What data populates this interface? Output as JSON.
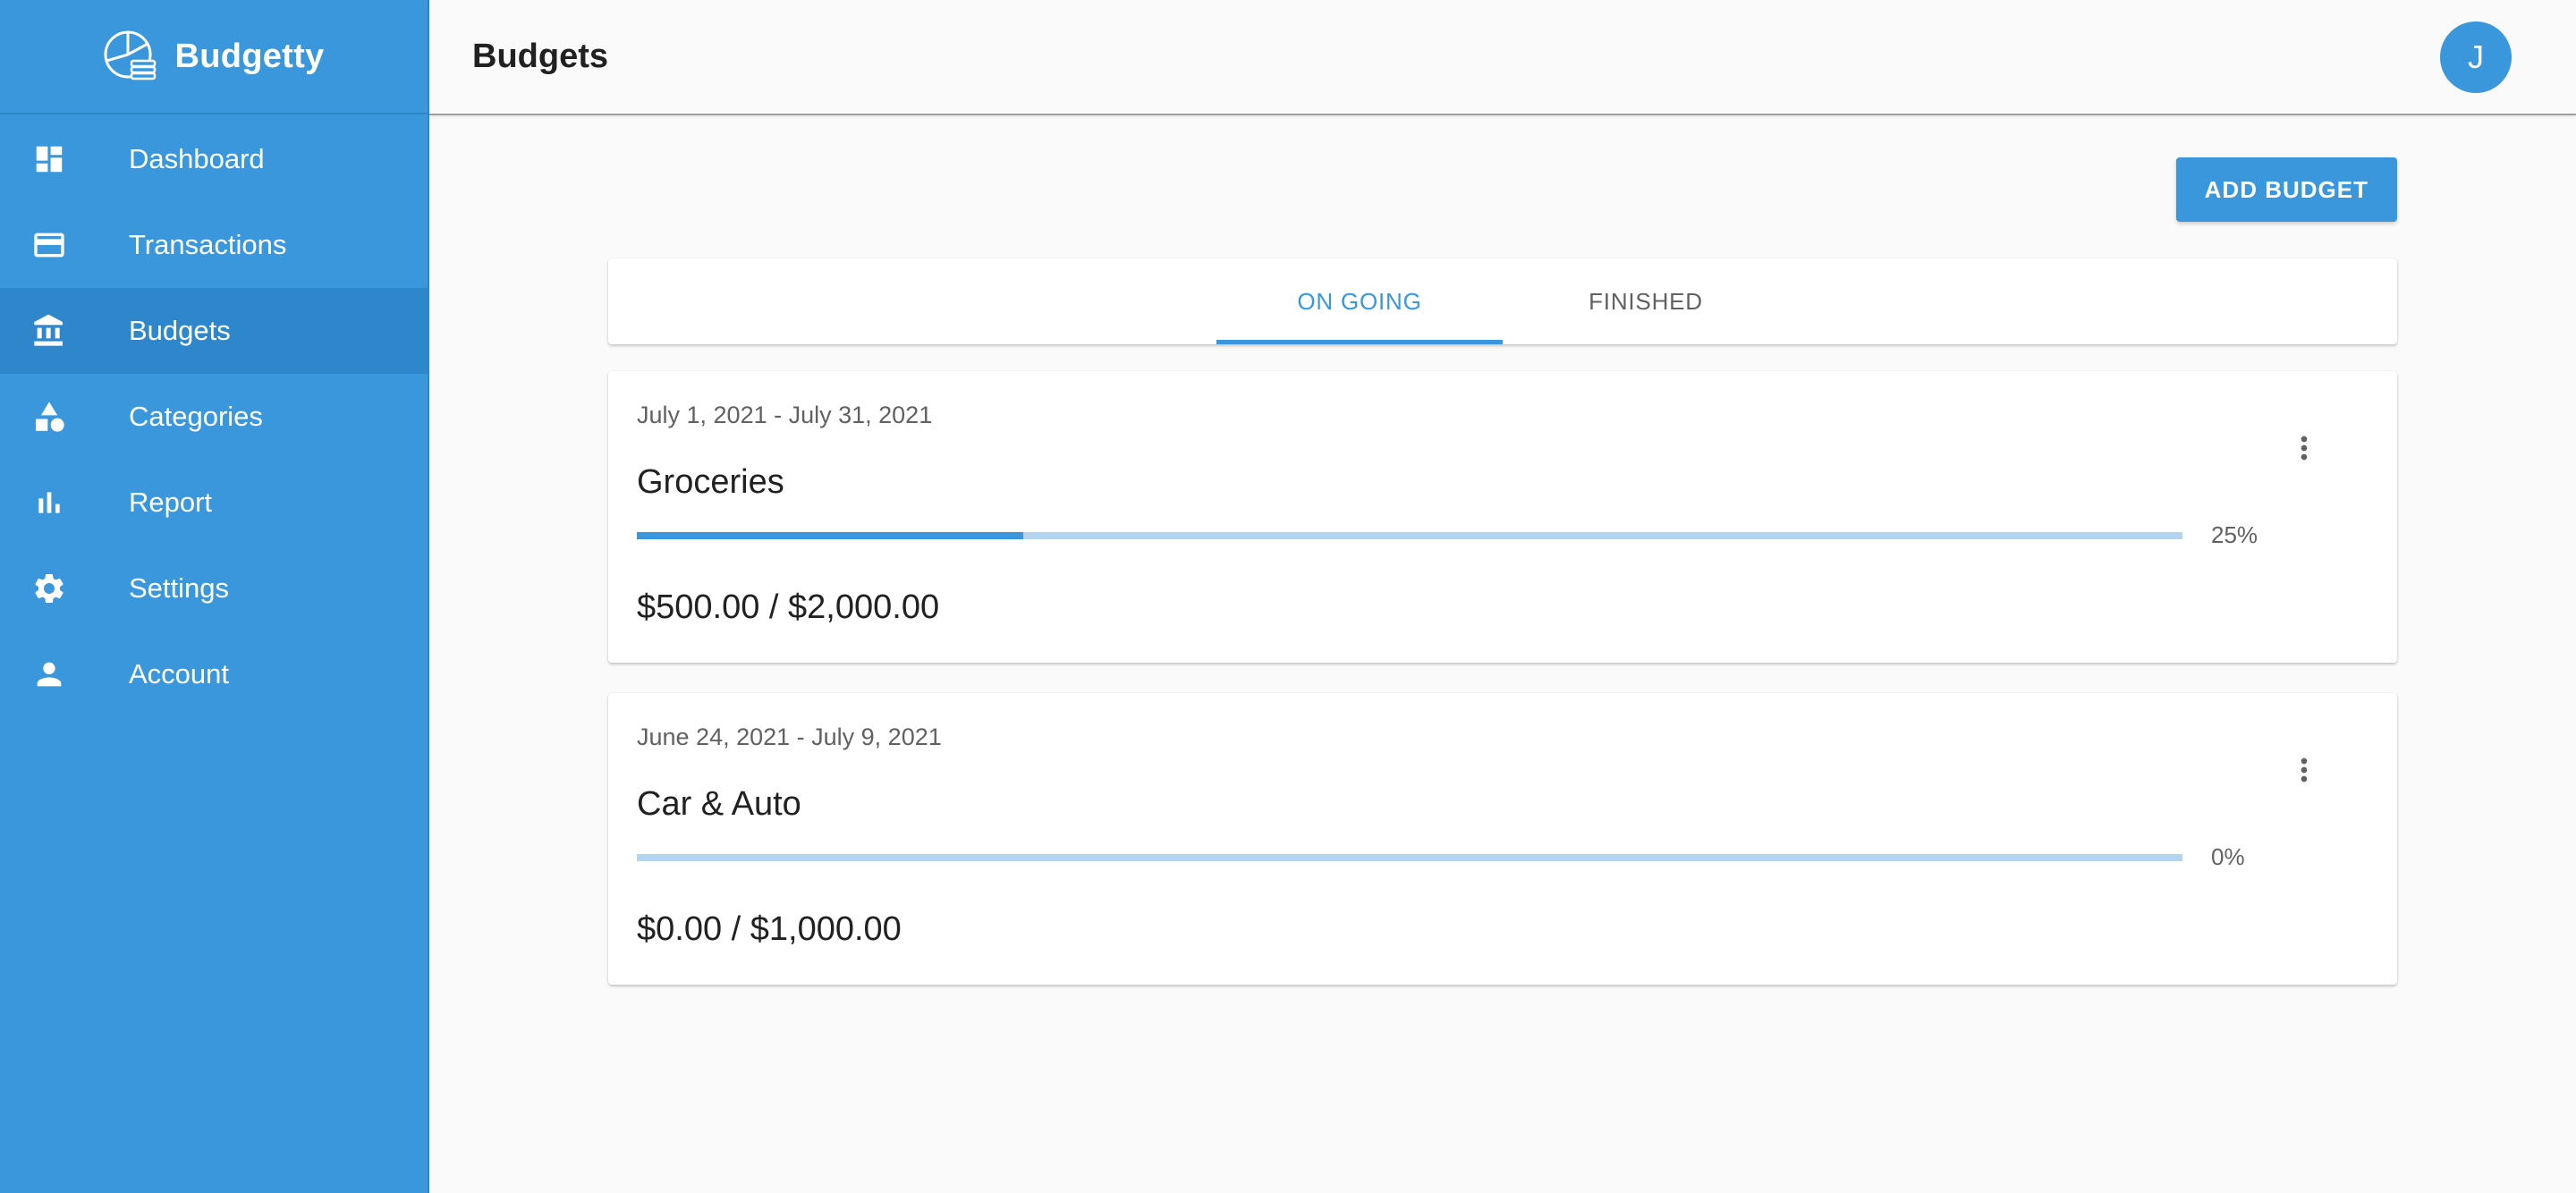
{
  "app": {
    "name": "Budgetty"
  },
  "sidebar": {
    "items": [
      {
        "label": "Dashboard",
        "icon": "dashboard-icon",
        "active": false
      },
      {
        "label": "Transactions",
        "icon": "credit-card-icon",
        "active": false
      },
      {
        "label": "Budgets",
        "icon": "bank-icon",
        "active": true
      },
      {
        "label": "Categories",
        "icon": "shapes-icon",
        "active": false
      },
      {
        "label": "Report",
        "icon": "bar-chart-icon",
        "active": false
      },
      {
        "label": "Settings",
        "icon": "gear-icon",
        "active": false
      },
      {
        "label": "Account",
        "icon": "person-icon",
        "active": false
      }
    ]
  },
  "header": {
    "title": "Budgets",
    "avatar_initial": "J"
  },
  "toolbar": {
    "add_label": "ADD BUDGET"
  },
  "tabs": [
    {
      "label": "ON GOING",
      "active": true
    },
    {
      "label": "FINISHED",
      "active": false
    }
  ],
  "budgets": [
    {
      "date_range": "July 1, 2021 - July 31, 2021",
      "name": "Groceries",
      "progress": 0.25,
      "percent_label": "25%",
      "amount": "$500.00 / $2,000.00"
    },
    {
      "date_range": "June 24, 2021 - July 9, 2021",
      "name": "Car & Auto",
      "progress": 0.0,
      "percent_label": "0%",
      "amount": "$0.00 / $1,000.00"
    }
  ],
  "colors": {
    "primary": "#3a97dc",
    "track": "#b3d5f1"
  }
}
